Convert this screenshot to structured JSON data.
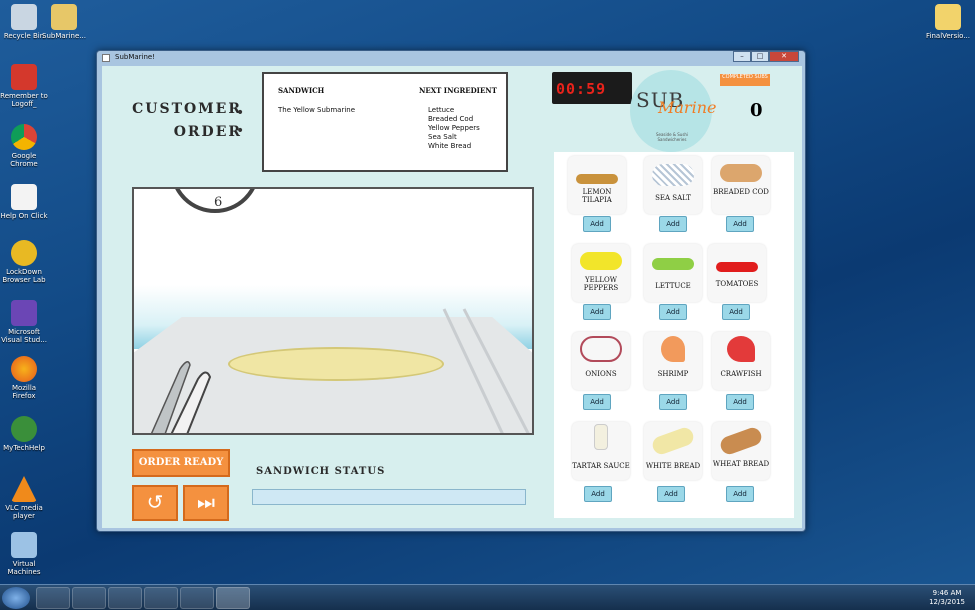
{
  "desktop": {
    "icons": [
      {
        "label": "Recycle Bin"
      },
      {
        "label": "SubMarine..."
      },
      {
        "label": "Remember to Logoff_"
      },
      {
        "label": "Google Chrome"
      },
      {
        "label": "Help On Click"
      },
      {
        "label": "LockDown Browser Lab"
      },
      {
        "label": "Microsoft Visual Stud..."
      },
      {
        "label": "Mozilla Firefox"
      },
      {
        "label": "MyTechHelp"
      },
      {
        "label": "VLC media player"
      },
      {
        "label": "Virtual Machines"
      },
      {
        "label": "FinalVersio..."
      }
    ]
  },
  "window": {
    "title": "SubMarine!",
    "customer_order_line1": "CUSTOMER",
    "customer_order_line2": "ORDER",
    "order_card": {
      "sandwich_header": "SANDWICH",
      "next_ingredient_header": "NEXT INGREDIENT",
      "sandwich_name": "The Yellow Submarine",
      "ingredients": [
        "Lettuce",
        "Breaded Cod",
        "Yellow Peppers",
        "Sea Salt",
        "White Bread"
      ]
    },
    "timer": "00:59",
    "logo": {
      "sub": "SUB",
      "marine": "Marine",
      "tagline": "Seaside & Sushi Sandwicheries"
    },
    "completed_label": "COMPLETED SUBS",
    "completed_count": "0",
    "clock_number": "6",
    "order_ready_label": "ORDER READY",
    "sandwich_status_label": "SANDWICH STATUS",
    "status_progress": 0.0,
    "add_label": "Add",
    "ingredient_cards": [
      {
        "name": "LEMON TILAPIA"
      },
      {
        "name": "SEA SALT"
      },
      {
        "name": "BREADED COD"
      },
      {
        "name": "YELLOW PEPPERS"
      },
      {
        "name": "LETTUCE"
      },
      {
        "name": "TOMATOES"
      },
      {
        "name": "ONIONS"
      },
      {
        "name": "SHRIMP"
      },
      {
        "name": "CRAWFISH"
      },
      {
        "name": "TARTAR SAUCE"
      },
      {
        "name": "WHITE BREAD"
      },
      {
        "name": "WHEAT BREAD"
      }
    ]
  },
  "taskbar": {
    "time": "9:46 AM",
    "date": "12/3/2015"
  },
  "colors": {
    "accent": "#f4913f",
    "add_button": "#9bd8e8",
    "timer_digits": "#e8231b",
    "client_bg": "#d7efee"
  }
}
